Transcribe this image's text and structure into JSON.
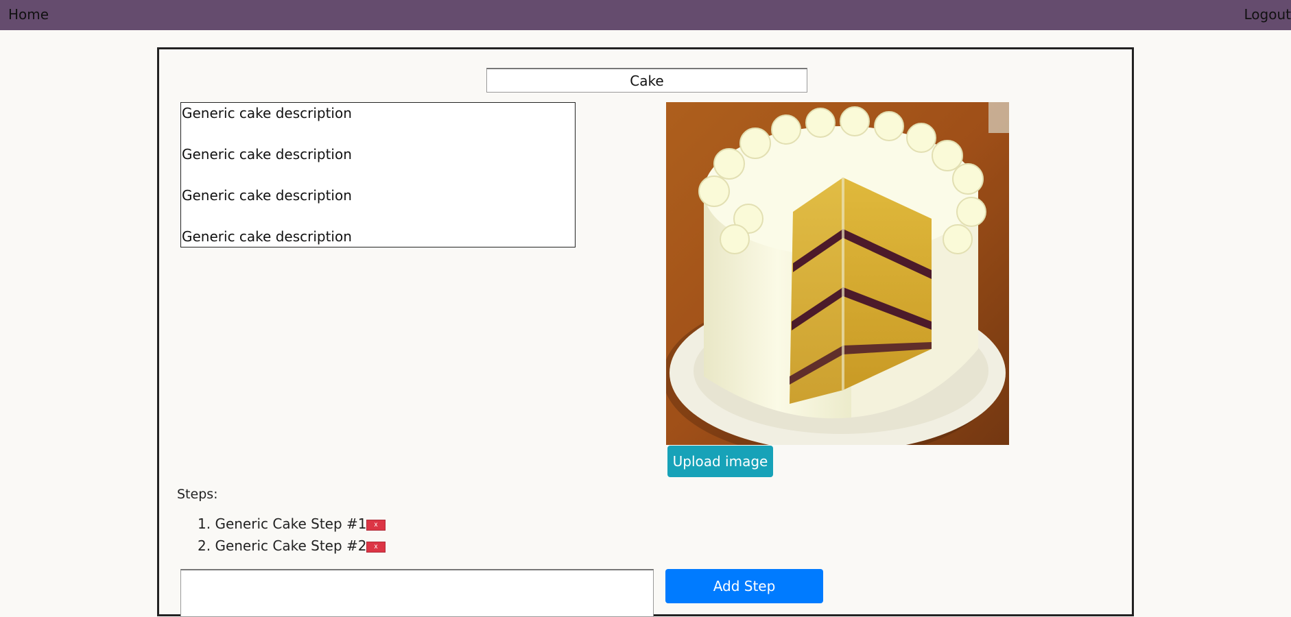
{
  "nav": {
    "home_label": "Home",
    "logout_label": "Logout"
  },
  "recipe": {
    "title": "Cake",
    "description_lines": [
      "Generic cake description",
      "Generic cake description",
      "Generic cake description",
      "Generic cake description"
    ],
    "upload_label": "Upload image",
    "steps_label": "Steps:",
    "steps": [
      {
        "number": "1.",
        "text": "Generic Cake Step #1",
        "remove_label": "x"
      },
      {
        "number": "2.",
        "text": "Generic Cake Step #2",
        "remove_label": "x"
      }
    ],
    "new_step_value": "",
    "add_step_label": "Add Step"
  },
  "colors": {
    "navbar": "#654c6e",
    "upload_button": "#17a2b8",
    "add_button": "#007bff",
    "remove_button": "#dc3545"
  }
}
